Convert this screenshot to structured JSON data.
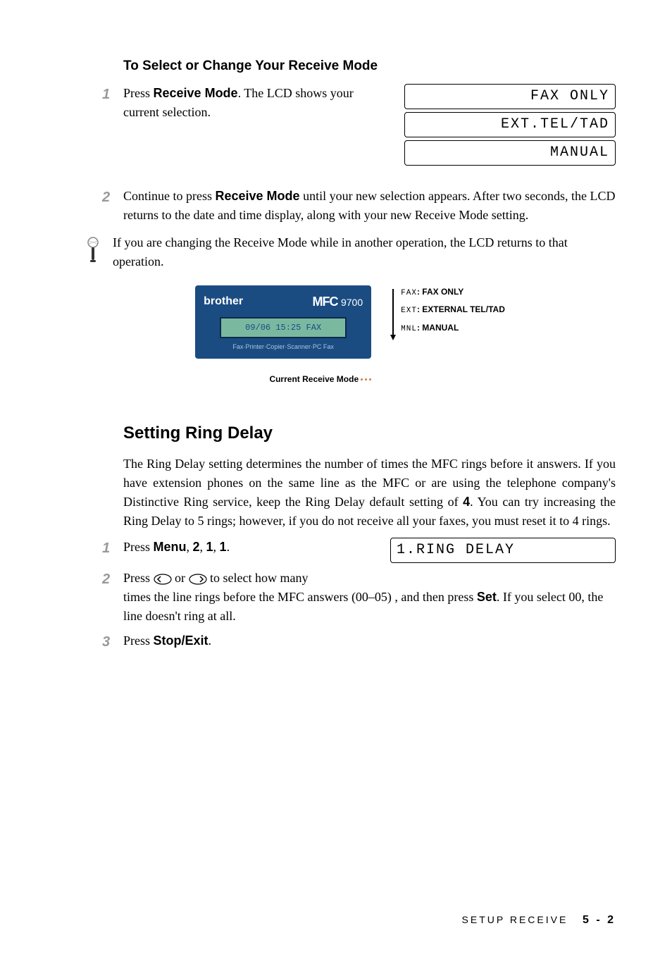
{
  "subheading": "To Select or Change Your Receive Mode",
  "step1": {
    "num": "1",
    "text_pre": " Press ",
    "button": "Receive Mode",
    "text_post": ". The LCD shows your current selection."
  },
  "lcd_options": [
    "FAX ONLY",
    "EXT.TEL/TAD",
    "MANUAL"
  ],
  "step2": {
    "num": "2",
    "text_pre": "Continue to press ",
    "button": "Receive Mode",
    "text_post": " until your new selection appears. After two seconds, the LCD returns to the date and time display, along with your new Receive Mode setting."
  },
  "note": "If you are changing the Receive Mode while in another operation, the LCD returns to that operation.",
  "device": {
    "brother": "brother",
    "mfc": "MFC",
    "model": "9700",
    "lcd": "09/06 15:25  FAX",
    "labels": "Fax·Printer·Copier·Scanner·PC Fax",
    "caption": "Current Receive Mode"
  },
  "legend": [
    {
      "code": "FAX",
      "sep": ": ",
      "label": "FAX ONLY"
    },
    {
      "code": "EXT",
      "sep": ": ",
      "label": "EXTERNAL TEL/TAD"
    },
    {
      "code": "MNL",
      "sep": ": ",
      "label": "MANUAL"
    }
  ],
  "section2": {
    "heading": "Setting Ring Delay",
    "para_pre": "The Ring Delay setting determines the number of times the MFC rings before it answers. If you have extension phones on the same line as the MFC or are using the telephone company's Distinctive Ring service, keep the Ring Delay default setting of ",
    "para_bold": "4",
    "para_post": ". You can try increasing the Ring Delay to 5 rings; however, if you do not receive all your faxes, you must reset it to 4 rings."
  },
  "s2step1": {
    "num": "1",
    "pre": "Press ",
    "b1": "Menu",
    "c1": ", ",
    "b2": "2",
    "c2": ", ",
    "b3": "1",
    "c3": ", ",
    "b4": "1",
    "post": ".",
    "lcd": "1.RING DELAY"
  },
  "s2step2": {
    "num": "2",
    "pre": "Press ",
    "mid": " or ",
    "post1": " to select how many",
    "post2_pre": "times the line rings before the MFC answers (00–05) , and then press ",
    "post2_btn": "Set",
    "post2_post": ". If you select 00, the line doesn't ring at all."
  },
  "s2step3": {
    "num": "3",
    "pre": "Press ",
    "btn": "Stop/Exit",
    "post": "."
  },
  "footer": {
    "section": "SETUP RECEIVE",
    "page": "5 - 2"
  }
}
